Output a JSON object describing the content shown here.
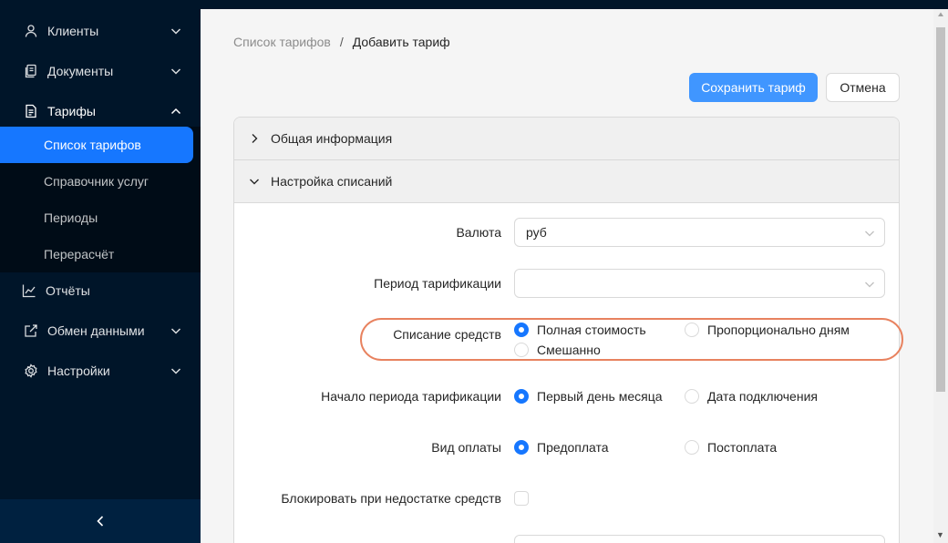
{
  "sidebar": {
    "menu": [
      {
        "label": "Клиенты",
        "icon": "user-icon",
        "chevron": "down"
      },
      {
        "label": "Документы",
        "icon": "documents-icon",
        "chevron": "down"
      },
      {
        "label": "Тарифы",
        "icon": "tariff-file-icon",
        "chevron": "up"
      },
      {
        "label": "Отчёты",
        "icon": "line-chart-icon",
        "chevron": ""
      },
      {
        "label": "Обмен данными",
        "icon": "edit-square-icon",
        "chevron": "down"
      },
      {
        "label": "Настройки",
        "icon": "gear-icon",
        "chevron": "down"
      }
    ],
    "submenu": [
      {
        "label": "Список тарифов",
        "active": true
      },
      {
        "label": "Справочник услуг",
        "active": false
      },
      {
        "label": "Периоды",
        "active": false
      },
      {
        "label": "Перерасчёт",
        "active": false
      }
    ],
    "collapse_icon": "chevron-left-icon"
  },
  "breadcrumb": {
    "parent": "Список тарифов",
    "separator": "/",
    "current": "Добавить тариф"
  },
  "actions": {
    "save_label": "Сохранить тариф",
    "cancel_label": "Отмена"
  },
  "panels": [
    {
      "title": "Общая информация",
      "expanded": false
    },
    {
      "title": "Настройка списаний",
      "expanded": true
    }
  ],
  "form": {
    "currency": {
      "label": "Валюта",
      "value": "руб"
    },
    "billing_period": {
      "label": "Период тарификации",
      "value": ""
    },
    "charge_mode": {
      "label": "Списание средств",
      "options": [
        "Полная стоимость",
        "Пропорционально дням",
        "Смешанно"
      ],
      "selected": "Полная стоимость"
    },
    "period_start": {
      "label": "Начало периода тарификации",
      "options": [
        "Первый день месяца",
        "Дата подключения"
      ],
      "selected": "Первый день месяца"
    },
    "payment_type": {
      "label": "Вид оплаты",
      "options": [
        "Предоплата",
        "Постоплата"
      ],
      "selected": "Предоплата"
    },
    "block_on_insufficient": {
      "label": "Блокировать при недостатке средств",
      "checked": false
    }
  },
  "colors": {
    "sidebar_bg": "#001529",
    "submenu_bg": "#000c17",
    "primary": "#1677ff",
    "button_primary": "#4096ff",
    "highlight": "#e8825f"
  }
}
